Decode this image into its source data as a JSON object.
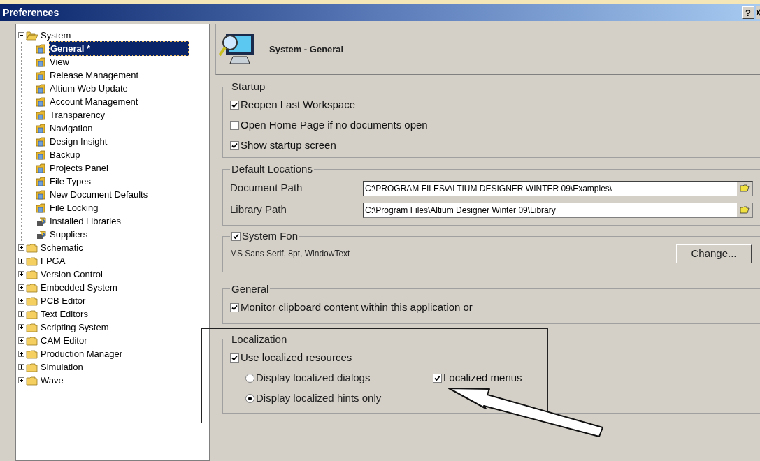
{
  "window": {
    "title": "Preferences",
    "help_button": "?"
  },
  "tree": [
    {
      "label": "System",
      "expanded": true,
      "selected": false,
      "children": [
        {
          "label": "General *",
          "selected": true,
          "kind": "page"
        },
        {
          "label": "View",
          "selected": false,
          "kind": "page"
        },
        {
          "label": "Release Management",
          "selected": false,
          "kind": "page"
        },
        {
          "label": "Altium Web Update",
          "selected": false,
          "kind": "page"
        },
        {
          "label": "Account Management",
          "selected": false,
          "kind": "page"
        },
        {
          "label": "Transparency",
          "selected": false,
          "kind": "page"
        },
        {
          "label": "Navigation",
          "selected": false,
          "kind": "page"
        },
        {
          "label": "Design Insight",
          "selected": false,
          "kind": "page"
        },
        {
          "label": "Backup",
          "selected": false,
          "kind": "page"
        },
        {
          "label": "Projects Panel",
          "selected": false,
          "kind": "page"
        },
        {
          "label": "File Types",
          "selected": false,
          "kind": "page"
        },
        {
          "label": "New Document Defaults",
          "selected": false,
          "kind": "page"
        },
        {
          "label": "File Locking",
          "selected": false,
          "kind": "page"
        },
        {
          "label": "Installed Libraries",
          "selected": false,
          "kind": "library"
        },
        {
          "label": "Suppliers",
          "selected": false,
          "kind": "library"
        }
      ]
    },
    {
      "label": "Schematic",
      "expanded": false,
      "selected": false
    },
    {
      "label": "FPGA",
      "expanded": false,
      "selected": false
    },
    {
      "label": "Version Control",
      "expanded": false,
      "selected": false
    },
    {
      "label": "Embedded System",
      "expanded": false,
      "selected": false
    },
    {
      "label": "PCB Editor",
      "expanded": false,
      "selected": false
    },
    {
      "label": "Text Editors",
      "expanded": false,
      "selected": false
    },
    {
      "label": "Scripting System",
      "expanded": false,
      "selected": false
    },
    {
      "label": "CAM Editor",
      "expanded": false,
      "selected": false
    },
    {
      "label": "Production Manager",
      "expanded": false,
      "selected": false
    },
    {
      "label": "Simulation",
      "expanded": false,
      "selected": false
    },
    {
      "label": "Wave",
      "expanded": false,
      "selected": false
    }
  ],
  "header": {
    "title": "System - General"
  },
  "startup": {
    "title": "Startup",
    "options": [
      {
        "label": "Reopen Last Workspace",
        "checked": true
      },
      {
        "label": "Open Home Page if no documents open",
        "checked": false
      },
      {
        "label": "Show startup screen",
        "checked": true
      }
    ]
  },
  "default_locations": {
    "title": "Default Locations",
    "fields": [
      {
        "label": "Document Path",
        "value": "C:\\PROGRAM FILES\\ALTIUM DESIGNER WINTER 09\\Examples\\"
      },
      {
        "label": "Library Path",
        "value": "C:\\Program Files\\Altium Designer Winter 09\\Library"
      }
    ]
  },
  "system_font": {
    "title": "System Fon",
    "checked": true,
    "description": "MS Sans Serif, 8pt, WindowText",
    "button": "Change..."
  },
  "general": {
    "title": "General",
    "options": [
      {
        "label": "Monitor clipboard content within this application or",
        "checked": true
      }
    ]
  },
  "localization": {
    "title": "Localization",
    "use_localized": {
      "label": "Use localized resources",
      "checked": true
    },
    "radios": [
      {
        "label": "Display localized dialogs",
        "selected": false
      },
      {
        "label": "Display localized hints only",
        "selected": true
      }
    ],
    "menus": {
      "label": "Localized menus",
      "checked": true
    }
  }
}
